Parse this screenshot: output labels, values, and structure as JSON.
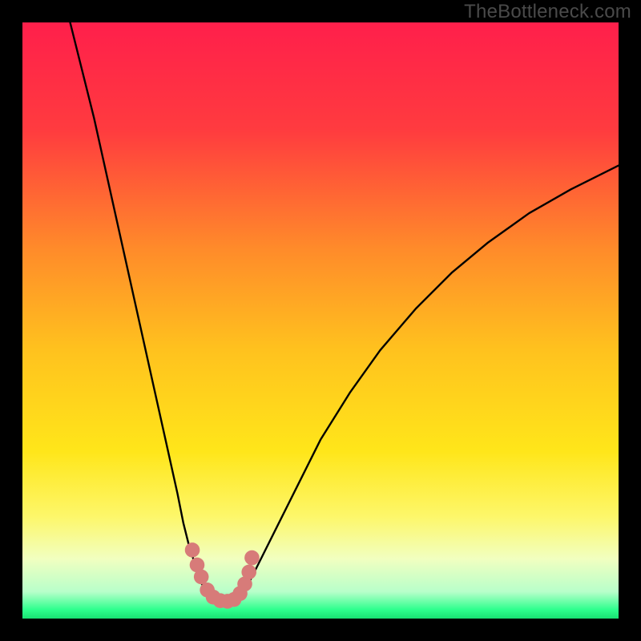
{
  "watermark": "TheBottleneck.com",
  "chart_data": {
    "type": "line",
    "title": "",
    "xlabel": "",
    "ylabel": "",
    "xlim": [
      0,
      100
    ],
    "ylim": [
      0,
      100
    ],
    "background_gradient_stops": [
      {
        "pos": 0.0,
        "color": "#ff1f4b"
      },
      {
        "pos": 0.18,
        "color": "#ff3b3f"
      },
      {
        "pos": 0.38,
        "color": "#ff8b2a"
      },
      {
        "pos": 0.55,
        "color": "#ffc21e"
      },
      {
        "pos": 0.72,
        "color": "#ffe61a"
      },
      {
        "pos": 0.83,
        "color": "#fdf76b"
      },
      {
        "pos": 0.9,
        "color": "#f1ffc0"
      },
      {
        "pos": 0.955,
        "color": "#b8ffca"
      },
      {
        "pos": 0.985,
        "color": "#2eff8d"
      },
      {
        "pos": 1.0,
        "color": "#18e072"
      }
    ],
    "series": [
      {
        "name": "left-falling-curve",
        "color": "#000000",
        "x": [
          8,
          10,
          12,
          14,
          16,
          18,
          20,
          22,
          24,
          26,
          27,
          28,
          29,
          30,
          31,
          32
        ],
        "y": [
          100,
          92,
          84,
          75,
          66,
          57,
          48,
          39,
          30,
          21,
          16,
          12,
          9,
          6,
          4,
          3
        ]
      },
      {
        "name": "right-rising-curve",
        "color": "#000000",
        "x": [
          36,
          38,
          40,
          43,
          46,
          50,
          55,
          60,
          66,
          72,
          78,
          85,
          92,
          100
        ],
        "y": [
          3,
          6,
          10,
          16,
          22,
          30,
          38,
          45,
          52,
          58,
          63,
          68,
          72,
          76
        ]
      },
      {
        "name": "bottom-flat",
        "color": "#000000",
        "x": [
          32,
          33,
          34,
          35,
          36
        ],
        "y": [
          3,
          2.8,
          2.7,
          2.8,
          3
        ]
      }
    ],
    "markers": {
      "name": "highlighted-points",
      "color": "#d77b79",
      "radius_pct": 1.25,
      "points": [
        {
          "x": 28.5,
          "y": 11.5
        },
        {
          "x": 29.3,
          "y": 9.0
        },
        {
          "x": 30.0,
          "y": 7.0
        },
        {
          "x": 31.0,
          "y": 4.8
        },
        {
          "x": 32.0,
          "y": 3.6
        },
        {
          "x": 33.2,
          "y": 3.0
        },
        {
          "x": 34.4,
          "y": 2.9
        },
        {
          "x": 35.5,
          "y": 3.2
        },
        {
          "x": 36.5,
          "y": 4.2
        },
        {
          "x": 37.3,
          "y": 5.8
        },
        {
          "x": 38.0,
          "y": 7.8
        },
        {
          "x": 38.5,
          "y": 10.2
        }
      ]
    }
  }
}
